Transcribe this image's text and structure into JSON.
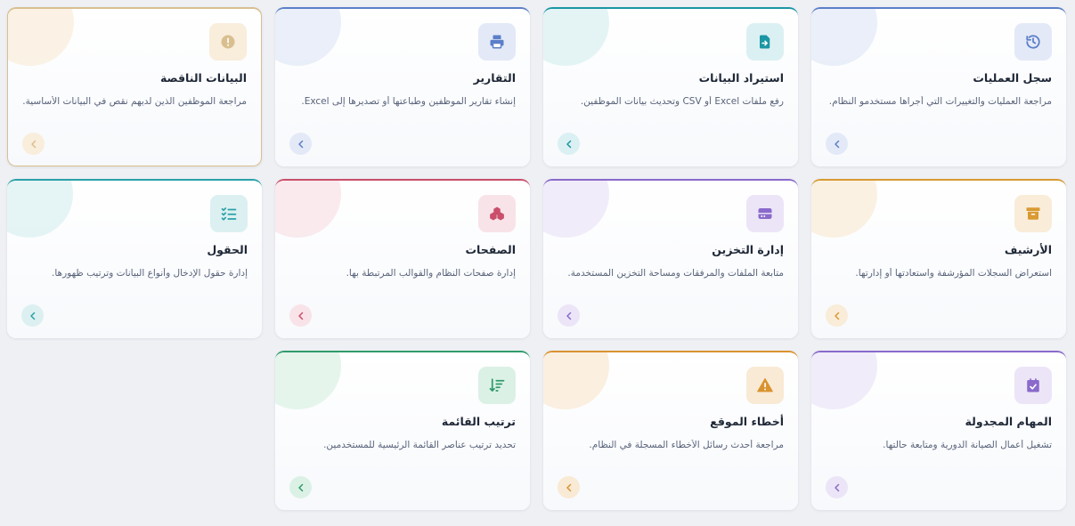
{
  "cards": [
    {
      "title": "سجل العمليات",
      "description": "مراجعة العمليات والتغييرات التي أجراها مستخدمو النظام.",
      "icon": "history-icon",
      "accent": "#5b7fc8",
      "soft": "#e3e9f7"
    },
    {
      "title": "استيراد البيانات",
      "description": "رفع ملفات Excel أو CSV وتحديث بيانات الموظفين.",
      "icon": "file-import-icon",
      "accent": "#1b96a4",
      "soft": "#dbf0f2"
    },
    {
      "title": "التقارير",
      "description": "إنشاء تقارير الموظفين وطباعتها أو تصديرها إلى Excel.",
      "icon": "printer-icon",
      "accent": "#5b7fc8",
      "soft": "#e3e9f7"
    },
    {
      "title": "البيانات الناقصة",
      "description": "مراجعة الموظفين الذين لديهم نقص في البيانات الأساسية.",
      "icon": "alert-circle-icon",
      "accent": "#d9bf8f",
      "soft": "#f9eddc",
      "active": true
    },
    {
      "title": "الأرشيف",
      "description": "استعراض السجلات المؤرشفة واستعادتها أو إدارتها.",
      "icon": "archive-icon",
      "accent": "#d99a33",
      "soft": "#f9ecd8"
    },
    {
      "title": "إدارة التخزين",
      "description": "متابعة الملفات والمرفقات ومساحة التخزين المستخدمة.",
      "icon": "storage-icon",
      "accent": "#8a6acb",
      "soft": "#ece5f7"
    },
    {
      "title": "الصفحات",
      "description": "إدارة صفحات النظام والقوالب المرتبطة بها.",
      "icon": "cubes-icon",
      "accent": "#c94f6a",
      "soft": "#f8e3e8"
    },
    {
      "title": "الحقول",
      "description": "إدارة حقول الإدخال وأنواع البيانات وترتيب ظهورها.",
      "icon": "list-check-icon",
      "accent": "#2aa1a8",
      "soft": "#dcf0f1"
    },
    {
      "title": "المهام المجدولة",
      "description": "تشغيل أعمال الصيانة الدورية ومتابعة حالتها.",
      "icon": "calendar-check-icon",
      "accent": "#8a6acb",
      "soft": "#ece5f7"
    },
    {
      "title": "أخطاء الموقع",
      "description": "مراجعة أحدث رسائل الأخطاء المسجلة في النظام.",
      "icon": "warning-triangle-icon",
      "accent": "#d9932f",
      "soft": "#f9ead5"
    },
    {
      "title": "ترتيب القائمة",
      "description": "تحديد ترتيب عناصر القائمة الرئيسية للمستخدمين.",
      "icon": "sort-icon",
      "accent": "#2f9b6b",
      "soft": "#dcf1e6"
    }
  ]
}
